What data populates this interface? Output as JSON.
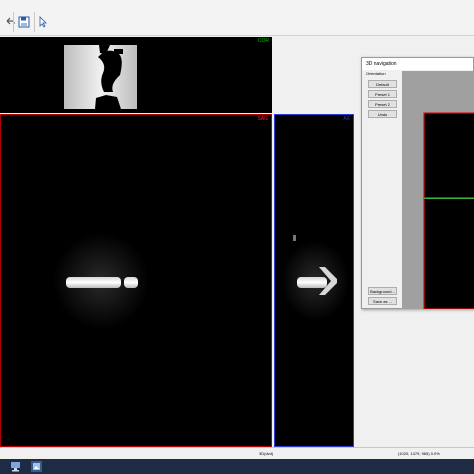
{
  "toolbar": {
    "icons": [
      "undo-icon",
      "save-icon",
      "pointer-icon"
    ]
  },
  "views": {
    "coronal_label": "COR",
    "sagittal_label": "SAG",
    "axial_label": "AX",
    "colors": {
      "coronal": "#00c000",
      "sagittal": "#ff2020",
      "axial": "#2a3bd6"
    }
  },
  "navigation": {
    "title": "3D navigation",
    "orientation_label": "Orientation",
    "buttons": {
      "default": "Default",
      "preset1": "Preset 1",
      "preset2": "Preset 2",
      "undo": "Undo",
      "background": "Background...",
      "save_as": "Save as ..."
    }
  },
  "status": {
    "left": "3D(dvd)",
    "right": "(1020, 1479, 965) 0.0%"
  },
  "taskbar": {
    "icons": [
      "network-icon",
      "app-icon"
    ]
  }
}
